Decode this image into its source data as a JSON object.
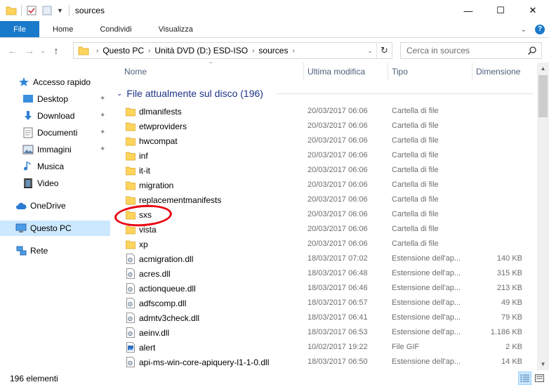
{
  "window": {
    "title": "sources",
    "minimize_glyph": "—",
    "maximize_glyph": "☐",
    "close_glyph": "✕"
  },
  "ribbon": {
    "tabs": [
      "File",
      "Home",
      "Condividi",
      "Visualizza"
    ],
    "expand_glyph": "⌄",
    "help_glyph": "?"
  },
  "address": {
    "back_glyph": "←",
    "forward_glyph": "→",
    "recent_glyph": "⌄",
    "up_glyph": "↑",
    "crumbs": [
      "Questo PC",
      "Unità DVD (D:) ESD-ISO",
      "sources"
    ],
    "crumb_sep": "›",
    "dropdown_glyph": "⌄",
    "refresh_glyph": "↻"
  },
  "search": {
    "placeholder": "Cerca in sources"
  },
  "nav": {
    "pin_glyph": "✦",
    "quick_access": "Accesso rapido",
    "desktop": "Desktop",
    "download": "Download",
    "documenti": "Documenti",
    "immagini": "Immagini",
    "musica": "Musica",
    "video": "Video",
    "onedrive": "OneDrive",
    "questo_pc": "Questo PC",
    "rete": "Rete"
  },
  "columns": {
    "sort_glyph": "⌃",
    "name": "Nome",
    "modified": "Ultima modifica",
    "type": "Tipo",
    "size": "Dimensione"
  },
  "group": {
    "chevron": "⌄",
    "title": "File attualmente sul disco (196)"
  },
  "files": [
    {
      "name": "dlmanifests",
      "date": "20/03/2017 06:06",
      "type": "Cartella di file",
      "size": "",
      "icon": "folder"
    },
    {
      "name": "etwproviders",
      "date": "20/03/2017 06:06",
      "type": "Cartella di file",
      "size": "",
      "icon": "folder"
    },
    {
      "name": "hwcompat",
      "date": "20/03/2017 06:06",
      "type": "Cartella di file",
      "size": "",
      "icon": "folder"
    },
    {
      "name": "inf",
      "date": "20/03/2017 06:06",
      "type": "Cartella di file",
      "size": "",
      "icon": "folder"
    },
    {
      "name": "it-it",
      "date": "20/03/2017 06:06",
      "type": "Cartella di file",
      "size": "",
      "icon": "folder"
    },
    {
      "name": "migration",
      "date": "20/03/2017 06:06",
      "type": "Cartella di file",
      "size": "",
      "icon": "folder"
    },
    {
      "name": "replacementmanifests",
      "date": "20/03/2017 06:06",
      "type": "Cartella di file",
      "size": "",
      "icon": "folder"
    },
    {
      "name": "sxs",
      "date": "20/03/2017 06:06",
      "type": "Cartella di file",
      "size": "",
      "icon": "folder"
    },
    {
      "name": "vista",
      "date": "20/03/2017 06:06",
      "type": "Cartella di file",
      "size": "",
      "icon": "folder"
    },
    {
      "name": "xp",
      "date": "20/03/2017 06:06",
      "type": "Cartella di file",
      "size": "",
      "icon": "folder"
    },
    {
      "name": "acmigration.dll",
      "date": "18/03/2017 07:02",
      "type": "Estensione dell'ap...",
      "size": "140 KB",
      "icon": "dll"
    },
    {
      "name": "acres.dll",
      "date": "18/03/2017 06:48",
      "type": "Estensione dell'ap...",
      "size": "315 KB",
      "icon": "dll"
    },
    {
      "name": "actionqueue.dll",
      "date": "18/03/2017 06:46",
      "type": "Estensione dell'ap...",
      "size": "213 KB",
      "icon": "dll"
    },
    {
      "name": "adfscomp.dll",
      "date": "18/03/2017 06:57",
      "type": "Estensione dell'ap...",
      "size": "49 KB",
      "icon": "dll"
    },
    {
      "name": "admtv3check.dll",
      "date": "18/03/2017 06:41",
      "type": "Estensione dell'ap...",
      "size": "79 KB",
      "icon": "dll"
    },
    {
      "name": "aeinv.dll",
      "date": "18/03/2017 06:53",
      "type": "Estensione dell'ap...",
      "size": "1.186 KB",
      "icon": "dll"
    },
    {
      "name": "alert",
      "date": "10/02/2017 19:22",
      "type": "File GIF",
      "size": "2 KB",
      "icon": "gif"
    },
    {
      "name": "api-ms-win-core-apiquery-l1-1-0.dll",
      "date": "18/03/2017 06:50",
      "type": "Estensione dell'ap...",
      "size": "14 KB",
      "icon": "dll"
    }
  ],
  "scroll": {
    "up_glyph": "▲",
    "down_glyph": "▼"
  },
  "status": {
    "count": "196 elementi"
  }
}
